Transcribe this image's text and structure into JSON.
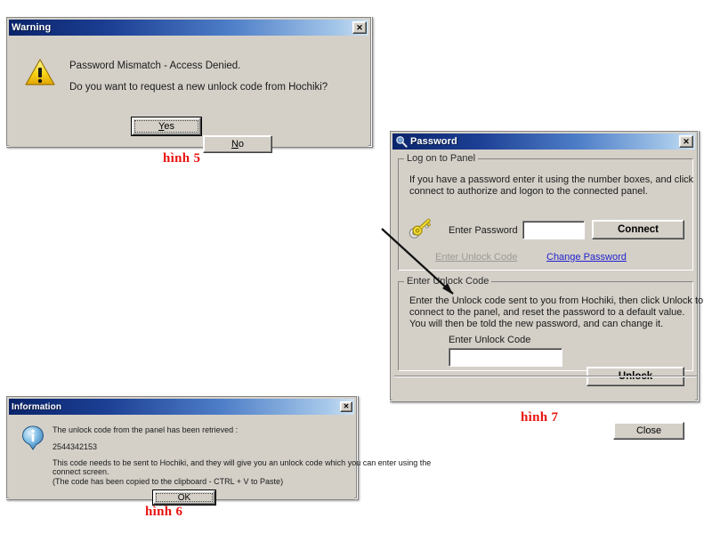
{
  "page": {
    "background": "#ffffff",
    "accent_titlebar_start": "#0a246a",
    "accent_titlebar_end": "#cfe2f3",
    "caption_color": "#e8140f",
    "dialog_face": "#d4d0c8",
    "link_color": "#2222cc",
    "disabled_link_color": "#9b9a96"
  },
  "warning_dialog": {
    "title": "Warning",
    "close_label": "✕",
    "icon": "warning-triangle-icon",
    "message_line1": "Password Mismatch - Access Denied.",
    "message_line2": "Do you want to request a new unlock code from Hochiki?",
    "yes_button": "Yes",
    "yes_accelerator": "Y",
    "no_button": "No",
    "no_accelerator": "N",
    "caption": "hình 5"
  },
  "information_dialog": {
    "title": "Information",
    "close_label": "✕",
    "icon": "information-circle-icon",
    "line1": "The unlock code from the panel has been retrieved :",
    "unlock_code": "2544342153",
    "line3": "This code needs to be sent to Hochiki, and they will give you an unlock code which you can enter using the",
    "line4": "connect screen.",
    "line5": "(The code has been copied to the clipboard - CTRL + V to Paste)",
    "ok_button": "OK",
    "caption": "hình 6"
  },
  "password_dialog": {
    "title": "Password",
    "title_icon": "magnifier-key-icon",
    "close_label": "✕",
    "caption": "hình 7",
    "logon_group": {
      "legend": "Log on to Panel",
      "description_line1": "If you have a password enter it using the number boxes, and click",
      "description_line2": "connect to authorize and logon to the connected panel.",
      "key_icon": "key-icon",
      "password_label": "Enter Password",
      "password_value": "",
      "password_placeholder": "",
      "connect_button": "Connect",
      "link_unlock": "Enter Unlock Code",
      "link_unlock_state": "disabled",
      "link_change_password": "Change Password",
      "link_change_password_state": "enabled"
    },
    "unlock_group": {
      "legend": "Enter Unlock Code",
      "description_line1": "Enter the Unlock code sent to you from Hochiki, then click Unlock to",
      "description_line2": "connect to the panel, and reset the password to a default value.",
      "description_line3": "You will then be told the new password, and can change it.",
      "field_label": "Enter Unlock Code",
      "field_value": "",
      "field_placeholder": "",
      "unlock_button": "Unlock"
    },
    "close_button": "Close"
  },
  "annotation": {
    "arrow": "pointer-arrow",
    "arrow_color": "#111111"
  }
}
